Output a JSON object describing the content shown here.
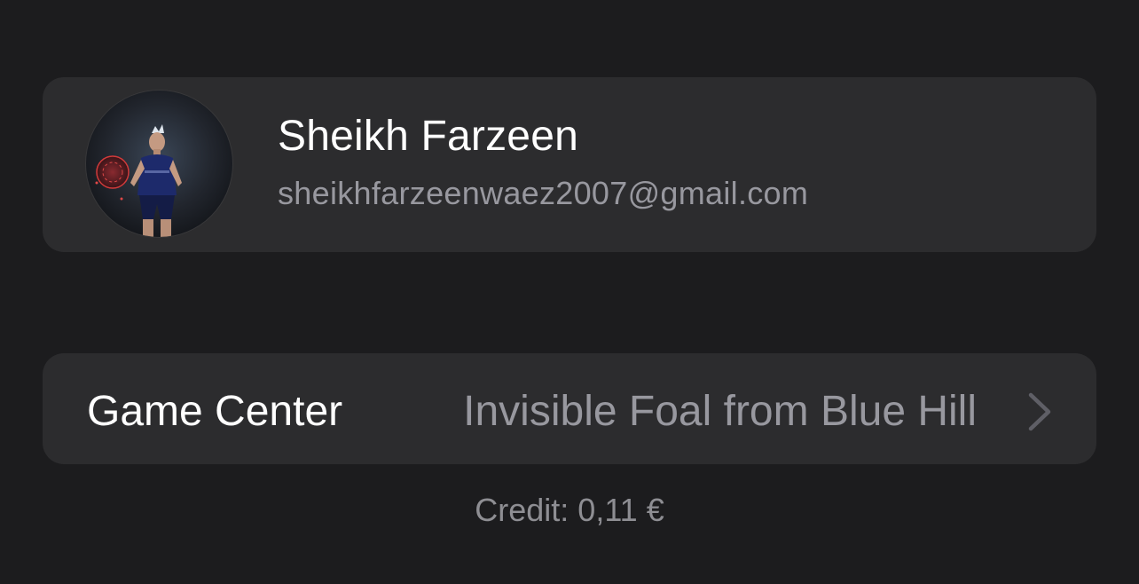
{
  "account": {
    "name": "Sheikh Farzeen",
    "email": "sheikhfarzeenwaez2007@gmail.com",
    "avatar": "avatar-photo"
  },
  "game_center": {
    "label": "Game Center",
    "value": "Invisible Foal from Blue Hill",
    "icon": "chevron-right-icon"
  },
  "credit": {
    "text": "Credit: 0,11 €"
  },
  "colors": {
    "background": "#1c1c1e",
    "card": "#2c2c2e",
    "primary_text": "#ffffff",
    "secondary_text": "#98989f"
  }
}
